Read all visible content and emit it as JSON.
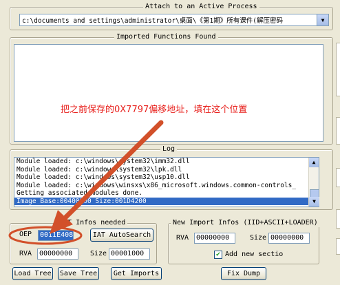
{
  "attach": {
    "title": "Attach to an Active Process",
    "process_path": "c:\\documents and settings\\administrator\\桌面\\《第1期》所有课件(解压密码"
  },
  "imported": {
    "title": "Imported Functions Found",
    "annotation": "把之前保存的0X7797偏移地址，填在这个位置"
  },
  "log": {
    "title": "Log",
    "lines": [
      "Module loaded: c:\\windows\\system32\\imm32.dll",
      "Module loaded: c:\\windows\\system32\\lpk.dll",
      "Module loaded: c:\\windows\\system32\\usp10.dll",
      "Module loaded: c:\\windows\\winsxs\\x86_microsoft.windows.common-controls_",
      "Getting associated modules done.",
      "Image Base:00400000 Size:001D4200"
    ],
    "selected_index": 5
  },
  "iat": {
    "title": "IAT Infos needed",
    "oep_label": "OEP",
    "oep_value": "0011E408",
    "autosearch_label": "IAT AutoSearch",
    "rva_label": "RVA",
    "rva_value": "00000000",
    "size_label": "Size",
    "size_value": "00001000"
  },
  "newimport": {
    "title": "New Import Infos (IID+ASCII+LOADER)",
    "rva_label": "RVA",
    "rva_value": "00000000",
    "size_label": "Size",
    "size_value": "00000000",
    "add_section_label": "Add new sectio",
    "add_section_checked": true
  },
  "buttons": {
    "load_tree": "Load Tree",
    "save_tree": "Save Tree",
    "get_imports": "Get Imports",
    "fix_dump": "Fix Dump"
  },
  "colors": {
    "annotation_red": "#e8201c",
    "arrow_red": "#d2502a",
    "selection_blue": "#316ac5"
  }
}
